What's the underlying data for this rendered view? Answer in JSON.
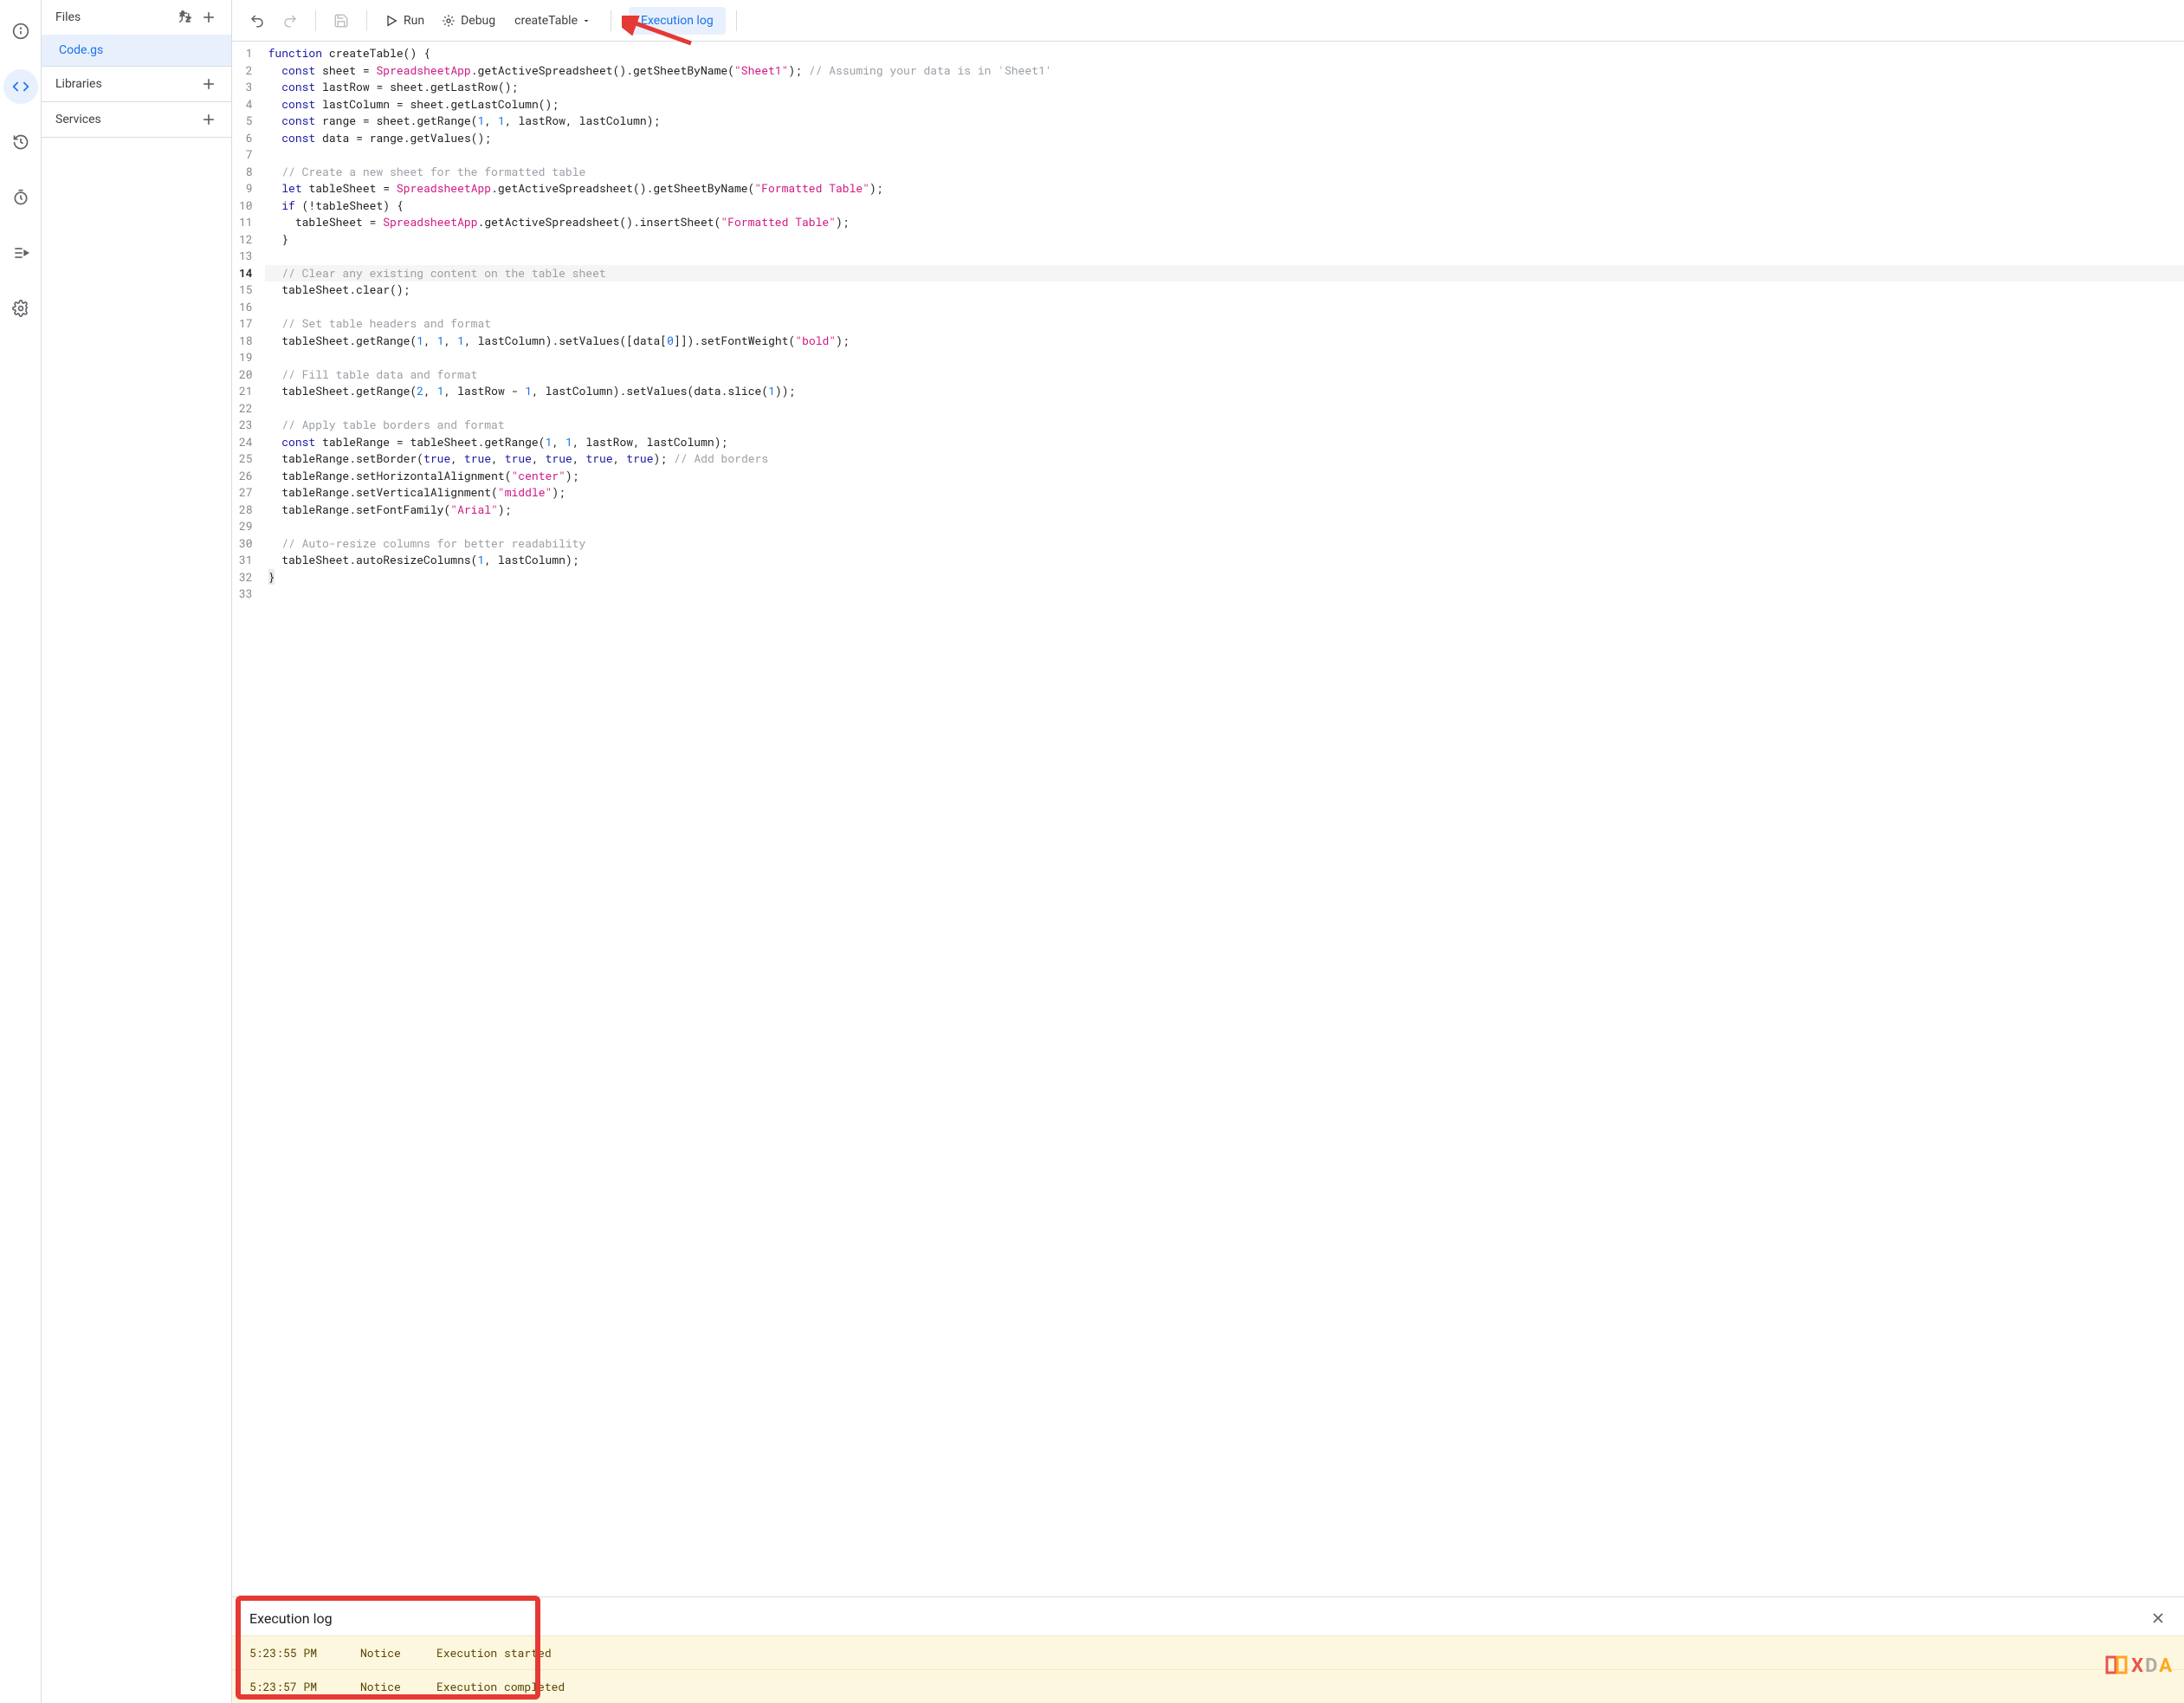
{
  "sidebar": {
    "files_label": "Files",
    "file_name": "Code.gs",
    "libraries_label": "Libraries",
    "services_label": "Services"
  },
  "toolbar": {
    "run_label": "Run",
    "debug_label": "Debug",
    "function_name": "createTable",
    "exec_log_label": "Execution log"
  },
  "code_lines": [
    {
      "n": 1,
      "html": "<span class='kw'>function</span> <span class='fn'>createTable</span><span class='punc'>(</span><span class='punc'>)</span> <span class='punc'>{</span>"
    },
    {
      "n": 2,
      "html": "  <span class='kw'>const</span> <span class='fn'>sheet</span> <span class='punc'>=</span> <span class='cls'>SpreadsheetApp</span><span class='punc'>.</span><span class='fn'>getActiveSpreadsheet</span><span class='punc'>().</span><span class='fn'>getSheetByName</span><span class='punc'>(</span><span class='str'>\"Sheet1\"</span><span class='punc'>);</span> <span class='cmt'>// Assuming your data is in 'Sheet1'</span>"
    },
    {
      "n": 3,
      "html": "  <span class='kw'>const</span> <span class='fn'>lastRow</span> <span class='punc'>=</span> <span class='fn'>sheet</span><span class='punc'>.</span><span class='fn'>getLastRow</span><span class='punc'>();</span>"
    },
    {
      "n": 4,
      "html": "  <span class='kw'>const</span> <span class='fn'>lastColumn</span> <span class='punc'>=</span> <span class='fn'>sheet</span><span class='punc'>.</span><span class='fn'>getLastColumn</span><span class='punc'>();</span>"
    },
    {
      "n": 5,
      "html": "  <span class='kw'>const</span> <span class='fn'>range</span> <span class='punc'>=</span> <span class='fn'>sheet</span><span class='punc'>.</span><span class='fn'>getRange</span><span class='punc'>(</span><span class='num'>1</span><span class='punc'>,</span> <span class='num'>1</span><span class='punc'>,</span> <span class='fn'>lastRow</span><span class='punc'>,</span> <span class='fn'>lastColumn</span><span class='punc'>);</span>"
    },
    {
      "n": 6,
      "html": "  <span class='kw'>const</span> <span class='fn'>data</span> <span class='punc'>=</span> <span class='fn'>range</span><span class='punc'>.</span><span class='fn'>getValues</span><span class='punc'>();</span>"
    },
    {
      "n": 7,
      "html": ""
    },
    {
      "n": 8,
      "html": "  <span class='cmt'>// Create a new sheet for the formatted table</span>"
    },
    {
      "n": 9,
      "html": "  <span class='kw'>let</span> <span class='fn'>tableSheet</span> <span class='punc'>=</span> <span class='cls'>SpreadsheetApp</span><span class='punc'>.</span><span class='fn'>getActiveSpreadsheet</span><span class='punc'>().</span><span class='fn'>getSheetByName</span><span class='punc'>(</span><span class='str'>\"Formatted Table\"</span><span class='punc'>);</span>"
    },
    {
      "n": 10,
      "html": "  <span class='kw'>if</span> <span class='punc'>(</span><span class='punc'>!</span><span class='fn'>tableSheet</span><span class='punc'>)</span> <span class='punc'>{</span>"
    },
    {
      "n": 11,
      "html": "    <span class='fn'>tableSheet</span> <span class='punc'>=</span> <span class='cls'>SpreadsheetApp</span><span class='punc'>.</span><span class='fn'>getActiveSpreadsheet</span><span class='punc'>().</span><span class='fn'>insertSheet</span><span class='punc'>(</span><span class='str'>\"Formatted Table\"</span><span class='punc'>);</span>"
    },
    {
      "n": 12,
      "html": "  <span class='punc'>}</span>"
    },
    {
      "n": 13,
      "html": ""
    },
    {
      "n": 14,
      "html": "  <span class='cmt'>// Clear any existing content on the table sheet</span>",
      "current": true
    },
    {
      "n": 15,
      "html": "  <span class='fn'>tableSheet</span><span class='punc'>.</span><span class='fn'>clear</span><span class='punc'>();</span>"
    },
    {
      "n": 16,
      "html": ""
    },
    {
      "n": 17,
      "html": "  <span class='cmt'>// Set table headers and format</span>"
    },
    {
      "n": 18,
      "html": "  <span class='fn'>tableSheet</span><span class='punc'>.</span><span class='fn'>getRange</span><span class='punc'>(</span><span class='num'>1</span><span class='punc'>,</span> <span class='num'>1</span><span class='punc'>,</span> <span class='num'>1</span><span class='punc'>,</span> <span class='fn'>lastColumn</span><span class='punc'>).</span><span class='fn'>setValues</span><span class='punc'>([</span><span class='fn'>data</span><span class='punc'>[</span><span class='num'>0</span><span class='punc'>]]).</span><span class='fn'>setFontWeight</span><span class='punc'>(</span><span class='str'>\"bold\"</span><span class='punc'>);</span>"
    },
    {
      "n": 19,
      "html": ""
    },
    {
      "n": 20,
      "html": "  <span class='cmt'>// Fill table data and format</span>"
    },
    {
      "n": 21,
      "html": "  <span class='fn'>tableSheet</span><span class='punc'>.</span><span class='fn'>getRange</span><span class='punc'>(</span><span class='num'>2</span><span class='punc'>,</span> <span class='num'>1</span><span class='punc'>,</span> <span class='fn'>lastRow</span> <span class='punc'>-</span> <span class='num'>1</span><span class='punc'>,</span> <span class='fn'>lastColumn</span><span class='punc'>).</span><span class='fn'>setValues</span><span class='punc'>(</span><span class='fn'>data</span><span class='punc'>.</span><span class='fn'>slice</span><span class='punc'>(</span><span class='num'>1</span><span class='punc'>));</span>"
    },
    {
      "n": 22,
      "html": ""
    },
    {
      "n": 23,
      "html": "  <span class='cmt'>// Apply table borders and format</span>"
    },
    {
      "n": 24,
      "html": "  <span class='kw'>const</span> <span class='fn'>tableRange</span> <span class='punc'>=</span> <span class='fn'>tableSheet</span><span class='punc'>.</span><span class='fn'>getRange</span><span class='punc'>(</span><span class='num'>1</span><span class='punc'>,</span> <span class='num'>1</span><span class='punc'>,</span> <span class='fn'>lastRow</span><span class='punc'>,</span> <span class='fn'>lastColumn</span><span class='punc'>);</span>"
    },
    {
      "n": 25,
      "html": "  <span class='fn'>tableRange</span><span class='punc'>.</span><span class='fn'>setBorder</span><span class='punc'>(</span><span class='kw'>true</span><span class='punc'>,</span> <span class='kw'>true</span><span class='punc'>,</span> <span class='kw'>true</span><span class='punc'>,</span> <span class='kw'>true</span><span class='punc'>,</span> <span class='kw'>true</span><span class='punc'>,</span> <span class='kw'>true</span><span class='punc'>);</span> <span class='cmt'>// Add borders</span>"
    },
    {
      "n": 26,
      "html": "  <span class='fn'>tableRange</span><span class='punc'>.</span><span class='fn'>setHorizontalAlignment</span><span class='punc'>(</span><span class='str'>\"center\"</span><span class='punc'>);</span>"
    },
    {
      "n": 27,
      "html": "  <span class='fn'>tableRange</span><span class='punc'>.</span><span class='fn'>setVerticalAlignment</span><span class='punc'>(</span><span class='str'>\"middle\"</span><span class='punc'>);</span>"
    },
    {
      "n": 28,
      "html": "  <span class='fn'>tableRange</span><span class='punc'>.</span><span class='fn'>setFontFamily</span><span class='punc'>(</span><span class='str'>\"Arial\"</span><span class='punc'>);</span>"
    },
    {
      "n": 29,
      "html": ""
    },
    {
      "n": 30,
      "html": "  <span class='cmt'>// Auto-resize columns for better readability</span>"
    },
    {
      "n": 31,
      "html": "  <span class='fn'>tableSheet</span><span class='punc'>.</span><span class='fn'>autoResizeColumns</span><span class='punc'>(</span><span class='num'>1</span><span class='punc'>,</span> <span class='fn'>lastColumn</span><span class='punc'>);</span>"
    },
    {
      "n": 32,
      "html": "<span class='punc hl-bracket'>}</span>"
    },
    {
      "n": 33,
      "html": ""
    }
  ],
  "exec_panel": {
    "title": "Execution log",
    "rows": [
      {
        "time": "5:23:55 PM",
        "level": "Notice",
        "msg": "Execution started"
      },
      {
        "time": "5:23:57 PM",
        "level": "Notice",
        "msg": "Execution completed"
      }
    ]
  },
  "watermark": "XDA"
}
